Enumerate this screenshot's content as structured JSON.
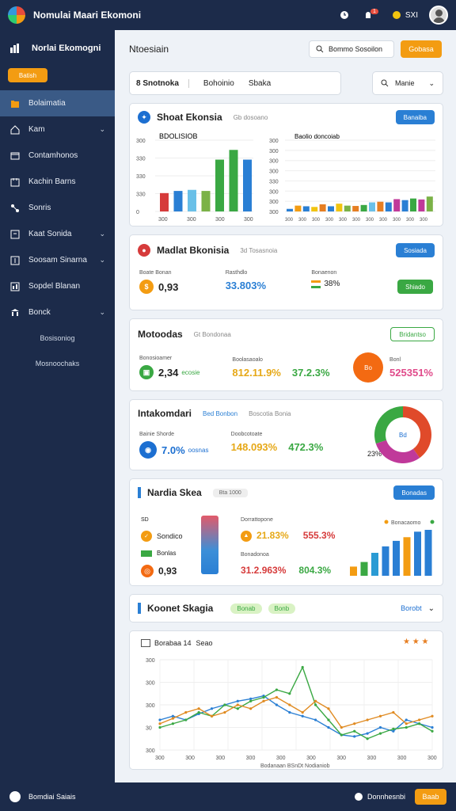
{
  "topbar": {
    "title": "Nomulai Maari Ekomoni",
    "badge": "1",
    "user_label": "SXI"
  },
  "sidebar": {
    "title": "Norlai Ekomogni",
    "pill": "Batish",
    "items": [
      {
        "label": "Bolaimatia",
        "icon": "folder-icon",
        "active": true,
        "chevron": false
      },
      {
        "label": "Kam",
        "icon": "home-icon",
        "chevron": true
      },
      {
        "label": "Contamhonos",
        "icon": "window-icon",
        "chevron": false
      },
      {
        "label": "Kachin Barns",
        "icon": "calendar-icon",
        "chevron": false
      },
      {
        "label": "Sonris",
        "icon": "network-icon",
        "chevron": false
      },
      {
        "label": "Kaat Sonida",
        "icon": "box-icon",
        "chevron": true
      },
      {
        "label": "Soosam Sinarna",
        "icon": "list-icon",
        "chevron": true
      },
      {
        "label": "Sopdel Blanan",
        "icon": "report-icon",
        "chevron": false
      },
      {
        "label": "Bonck",
        "icon": "bank-icon",
        "chevron": true
      }
    ],
    "subitems": [
      "Bosisoniog",
      "Mosnoochaks"
    ]
  },
  "header": {
    "title": "Ntoesiain",
    "search_label": "Bommo Sosoilon",
    "action_label": "Gobasa"
  },
  "tabs": {
    "items": [
      "Snotnoka",
      "Bohoinio",
      "Sbaka"
    ],
    "selected_prefix": "8"
  },
  "dropdown": {
    "label": "Manie"
  },
  "card1": {
    "title": "Shoat Ekonsia",
    "subtitle": "Gb dosoano",
    "button": "Banaiba",
    "left_chart_caption": "BDOLISIOB",
    "right_chart_caption": "Baolio doncoiab"
  },
  "card2": {
    "title": "Madlat Bkonisia",
    "subtitle": "3d Tosasnoia",
    "button": "Sosiada",
    "stats": [
      {
        "label": "Boate Bonan",
        "value": "0,93"
      },
      {
        "label": "Rasthdlo",
        "value": "33.803%"
      },
      {
        "label": "Bonaenon",
        "value": "38%"
      }
    ],
    "side_button": "Shiado"
  },
  "card3": {
    "title": "Motoodas",
    "subtitle": "Gt Bondonaa",
    "button": "Bridantso",
    "stats": [
      {
        "label": "Bonosioamer",
        "value": "2,34",
        "suffix": "ecosie"
      },
      {
        "label": "Boolasaoalo",
        "value": "812.11.9%",
        "value2": "37.2.3%"
      },
      {
        "label": "Bonl",
        "value": "525351%"
      }
    ],
    "circle_label": "Bo"
  },
  "card4": {
    "title": "Intakomdari",
    "subtitle": "Bed Bonbon",
    "subtitle2": "Boscotia Bonia",
    "stats": [
      {
        "label": "Bainie Shorde",
        "value": "7.0%",
        "suffix": "oosnas"
      },
      {
        "label": "Doobcotoate",
        "value": "148.093%",
        "value2": "472.3%"
      }
    ],
    "donut_label": "Bd",
    "donut_outer": "23%"
  },
  "card5": {
    "title": "Nardia Skea",
    "chip": "Bta 1000",
    "button": "Bonadas",
    "items": [
      {
        "label": "Sondico",
        "prefix": "SD"
      },
      {
        "label": "Bonlas"
      },
      {
        "label": "0,93"
      }
    ],
    "mid_labels": [
      "Dorrattopone",
      "Bonadonoa"
    ],
    "mid_values": [
      "21.83%",
      "555.3%",
      "31.2.963%",
      "804.3%"
    ],
    "legend": "Bonacaomo"
  },
  "card6": {
    "title": "Koonet Skagia",
    "chips": [
      "Bonab",
      "Bonb"
    ],
    "select": "Borobt"
  },
  "card7": {
    "title": "Borabaa 14",
    "subtitle": "Seao",
    "xlabel": "Bodanaan BSnDt Nodianiob"
  },
  "chart_data": [
    {
      "type": "bar",
      "title": "BDOLISIOB",
      "categories": [
        "300",
        "300",
        "300",
        "300",
        "300",
        "300"
      ],
      "x_tick_labels": [
        "300",
        "300",
        "300",
        "300"
      ],
      "y_tick_labels": [
        "300",
        "330",
        "330",
        "330",
        "0"
      ],
      "ylim": [
        0,
        330
      ],
      "series": [
        {
          "values": [
            85,
            95,
            100,
            95,
            240,
            285,
            240
          ]
        }
      ],
      "colors": [
        "#d63b3b",
        "#2a7fd4",
        "#6ac0e8",
        "#7bb247",
        "#3aa843",
        "#3aa843",
        "#2a7fd4"
      ]
    },
    {
      "type": "bar",
      "title": "Baolio doncoiab",
      "y_tick_labels": [
        "300",
        "300",
        "300",
        "300",
        "330",
        "300",
        "300",
        "300"
      ],
      "x_tick_labels": [
        "300",
        "300",
        "300",
        "300",
        "300",
        "300",
        "300",
        "300",
        "300",
        "300",
        "300"
      ],
      "ylim": [
        0,
        330
      ],
      "values": [
        40,
        90,
        80,
        70,
        110,
        80,
        120,
        90,
        85,
        100,
        140,
        150,
        140,
        190,
        175,
        200,
        185,
        230
      ],
      "colors": [
        "#2a7fd4",
        "#f39c12",
        "#2a7fd4",
        "#f1c40f",
        "#e67e22",
        "#2a7fd4",
        "#f1c40f",
        "#7bb247",
        "#e67e22",
        "#3aa843",
        "#6ac0e8",
        "#e67e22",
        "#2a7fd4",
        "#c0399a",
        "#2a7fd4",
        "#3aa843",
        "#c0399a",
        "#7bb247"
      ]
    },
    {
      "type": "bar",
      "title": "Bonacaomo",
      "values": [
        10,
        15,
        25,
        32,
        38,
        42,
        48,
        50
      ],
      "colors": [
        "#f39c12",
        "#3aa843",
        "#2a9bd4",
        "#2a7fd4",
        "#2a7fd4",
        "#f39c12",
        "#2a7fd4",
        "#2a7fd4"
      ]
    },
    {
      "type": "line",
      "title": "Borabaa 14",
      "xlabel": "Bodanaan BSnDt Nodianiob",
      "x_tick_labels": [
        "300",
        "300",
        "300",
        "300",
        "300",
        "300",
        "300",
        "300",
        "300",
        "300"
      ],
      "y_tick_labels": [
        "300",
        "300",
        "300",
        "30",
        "300"
      ],
      "series": [
        {
          "color": "#2a7fd4",
          "values": [
            140,
            145,
            140,
            148,
            155,
            160,
            165,
            168,
            172,
            160,
            150,
            145,
            140,
            130,
            120,
            118,
            122,
            130,
            125,
            140,
            135,
            130
          ]
        },
        {
          "color": "#3aa843",
          "values": [
            130,
            135,
            140,
            150,
            145,
            160,
            155,
            165,
            170,
            180,
            175,
            210,
            160,
            140,
            120,
            125,
            115,
            122,
            128,
            130,
            135,
            125
          ]
        },
        {
          "color": "#e08a20",
          "values": [
            135,
            142,
            150,
            155,
            145,
            150,
            160,
            155,
            165,
            170,
            160,
            150,
            165,
            155,
            130,
            135,
            140,
            145,
            150,
            135,
            140,
            145
          ]
        }
      ]
    },
    {
      "type": "pie",
      "title": "Bd",
      "values": [
        40,
        30,
        30
      ],
      "colors": [
        "#e04a2a",
        "#c0399a",
        "#3aa843"
      ]
    }
  ],
  "footer": {
    "left": "Bomdiai Saiais",
    "right_label": "Donnhesnbi",
    "button": "Baab"
  },
  "colors": {
    "navy": "#1c2b4a",
    "orange": "#f39c12",
    "blue": "#2a7fd4",
    "green": "#3aa843",
    "red": "#e74c3c"
  }
}
